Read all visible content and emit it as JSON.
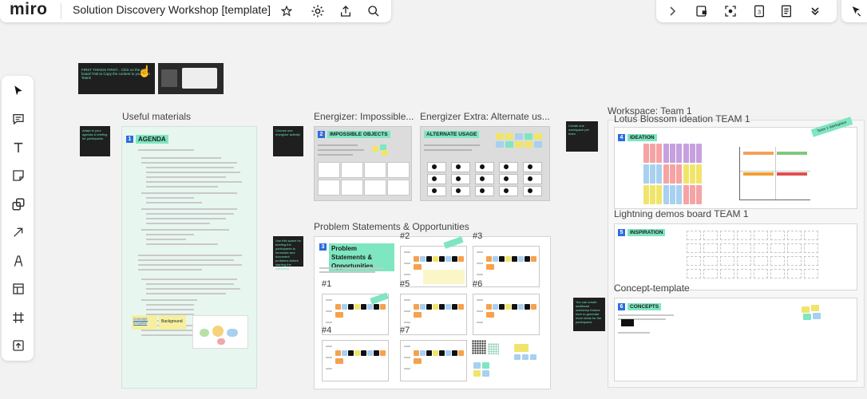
{
  "app": {
    "logo": "miro",
    "board_title": "Solution Discovery Workshop [template]"
  },
  "topbar_icons": [
    "star-icon",
    "gear-icon",
    "share-icon",
    "search-icon"
  ],
  "right_toolbar_icons": [
    "chevron-right-icon",
    "present-icon",
    "focus-icon",
    "timer-icon",
    "notes-icon",
    "chevron-double-down-icon",
    "cursor-icon"
  ],
  "left_toolbar_icons": [
    "select-icon",
    "comment-icon",
    "text-icon",
    "sticky-note-icon",
    "shapes-icon",
    "arrow-icon",
    "pen-icon",
    "templates-icon",
    "frame-icon",
    "upload-icon"
  ],
  "intro_sticky": "FIRST THINGS FIRST... Click on the miro board TAB to Copy the content to your own Team!",
  "frames": {
    "useful_materials": "Useful materials",
    "energizer": "Energizer: Impossible...",
    "energizer_extra": "Energizer Extra: Alternate us...",
    "problem": "Problem Statements & Opportunities",
    "workspace": "Workspace: Team 1",
    "lotus": "Lotus Blossom ideation TEAM 1",
    "lightning": "Lightning demos board TEAM 1",
    "concept": "Concept-template"
  },
  "stickies": {
    "adapt": "Adapt to your agenda & briefing for participants",
    "choose": "Choose one energizer activity!",
    "problem_note": "Use this space for briefing the participants to formulate and document problems before starting the workshop",
    "workspace_note": "Create one workspace per team",
    "concept_note": "You can create additional workshop frames here to generate more ideas for the participants"
  },
  "sections": {
    "agenda": {
      "num": "1",
      "title": "AGENDA"
    },
    "impossible": {
      "num": "2",
      "title": "IMPOSSIBLE OBJECTS"
    },
    "alternate": {
      "title": "ALTERNATE USAGE"
    },
    "problem": {
      "num": "3",
      "title": "Problem Statements & Opportunities"
    },
    "ideation": {
      "num": "4",
      "title": "IDEATION"
    },
    "inspiration": {
      "num": "5",
      "title": "INSPIRATION"
    },
    "concepts": {
      "num": "6",
      "title": "CONCEPTS"
    }
  },
  "agenda_extras": {
    "concept_note": "Concept-template",
    "background": "Background"
  },
  "team_badge": "Team 1 Workspace",
  "problem_cards": [
    "#1",
    "#2",
    "#3",
    "#4",
    "#5",
    "#6",
    "#7"
  ],
  "colors": {
    "accent": "#2d6cdf",
    "mint": "#7ee6c1",
    "agenda_bg": "#e8f6f0",
    "sticky_dark": "#1f1f1f"
  }
}
